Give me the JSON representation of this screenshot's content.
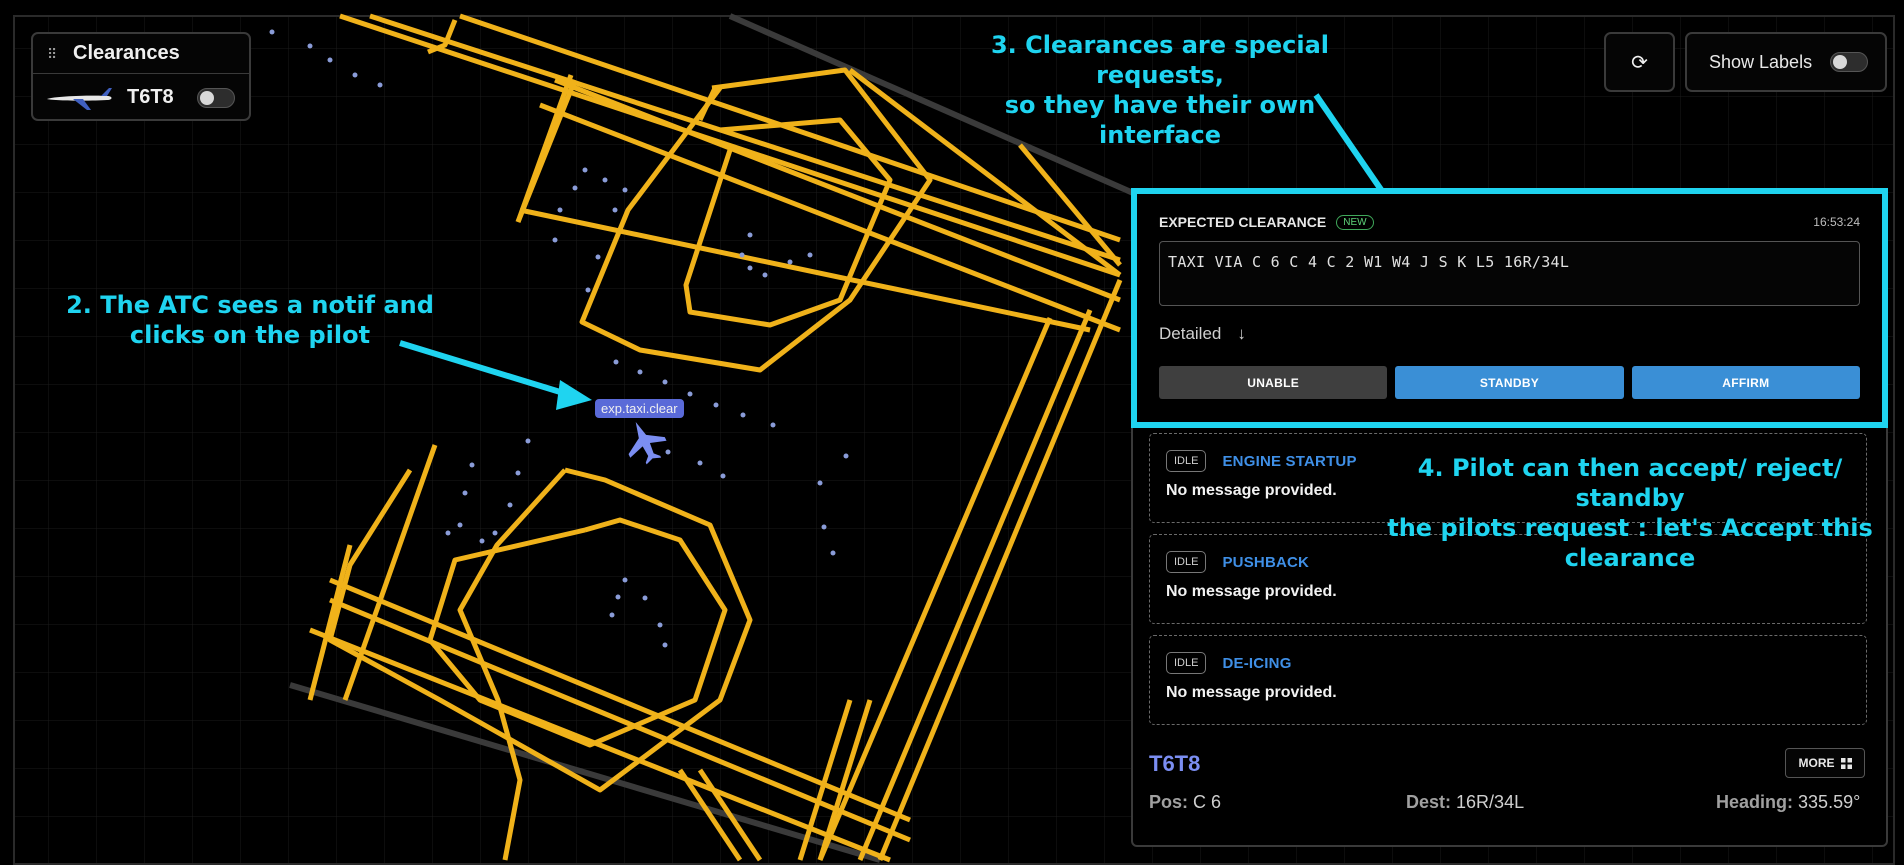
{
  "clearances_panel": {
    "title": "Clearances",
    "pilot_callsign": "T6T8"
  },
  "top_controls": {
    "refresh_icon": "refresh-icon",
    "show_labels": "Show Labels"
  },
  "map": {
    "aircraft_label": "exp.taxi.clear"
  },
  "clearance": {
    "title": "EXPECTED CLEARANCE",
    "badge": "NEW",
    "time": "16:53:24",
    "text": "TAXI VIA C 6 C 4 C 2 W1 W4 J S K L5 16R/34L",
    "detailed": "Detailed",
    "detailed_arrow": "↓",
    "buttons": {
      "unable": "UNABLE",
      "standby": "STANDBY",
      "affirm": "AFFIRM"
    }
  },
  "requests": [
    {
      "status": "IDLE",
      "name": "ENGINE STARTUP",
      "message": "No message provided."
    },
    {
      "status": "IDLE",
      "name": "PUSHBACK",
      "message": "No message provided."
    },
    {
      "status": "IDLE",
      "name": "DE-ICING",
      "message": "No message provided."
    }
  ],
  "info": {
    "callsign": "T6T8",
    "more": "MORE",
    "pos_label": "Pos:",
    "pos_value": "C 6",
    "dest_label": "Dest:",
    "dest_value": "16R/34L",
    "heading_label": "Heading:",
    "heading_value": "335.59°"
  },
  "annotations": {
    "a2_line1": "2. The ATC sees a notif and",
    "a2_line2": "clicks on the pilot",
    "a3_line1": "3. Clearances are special requests,",
    "a3_line2": "so they have their own interface",
    "a4_line1": "4. Pilot can then accept/ reject/ standby",
    "a4_line2": "the pilots request : let's Accept this clearance"
  },
  "colors": {
    "taxiway": "#f0b21a",
    "annotation": "#1fd4f0",
    "accent": "#3a8fd6",
    "callsign": "#7b8ef2"
  }
}
